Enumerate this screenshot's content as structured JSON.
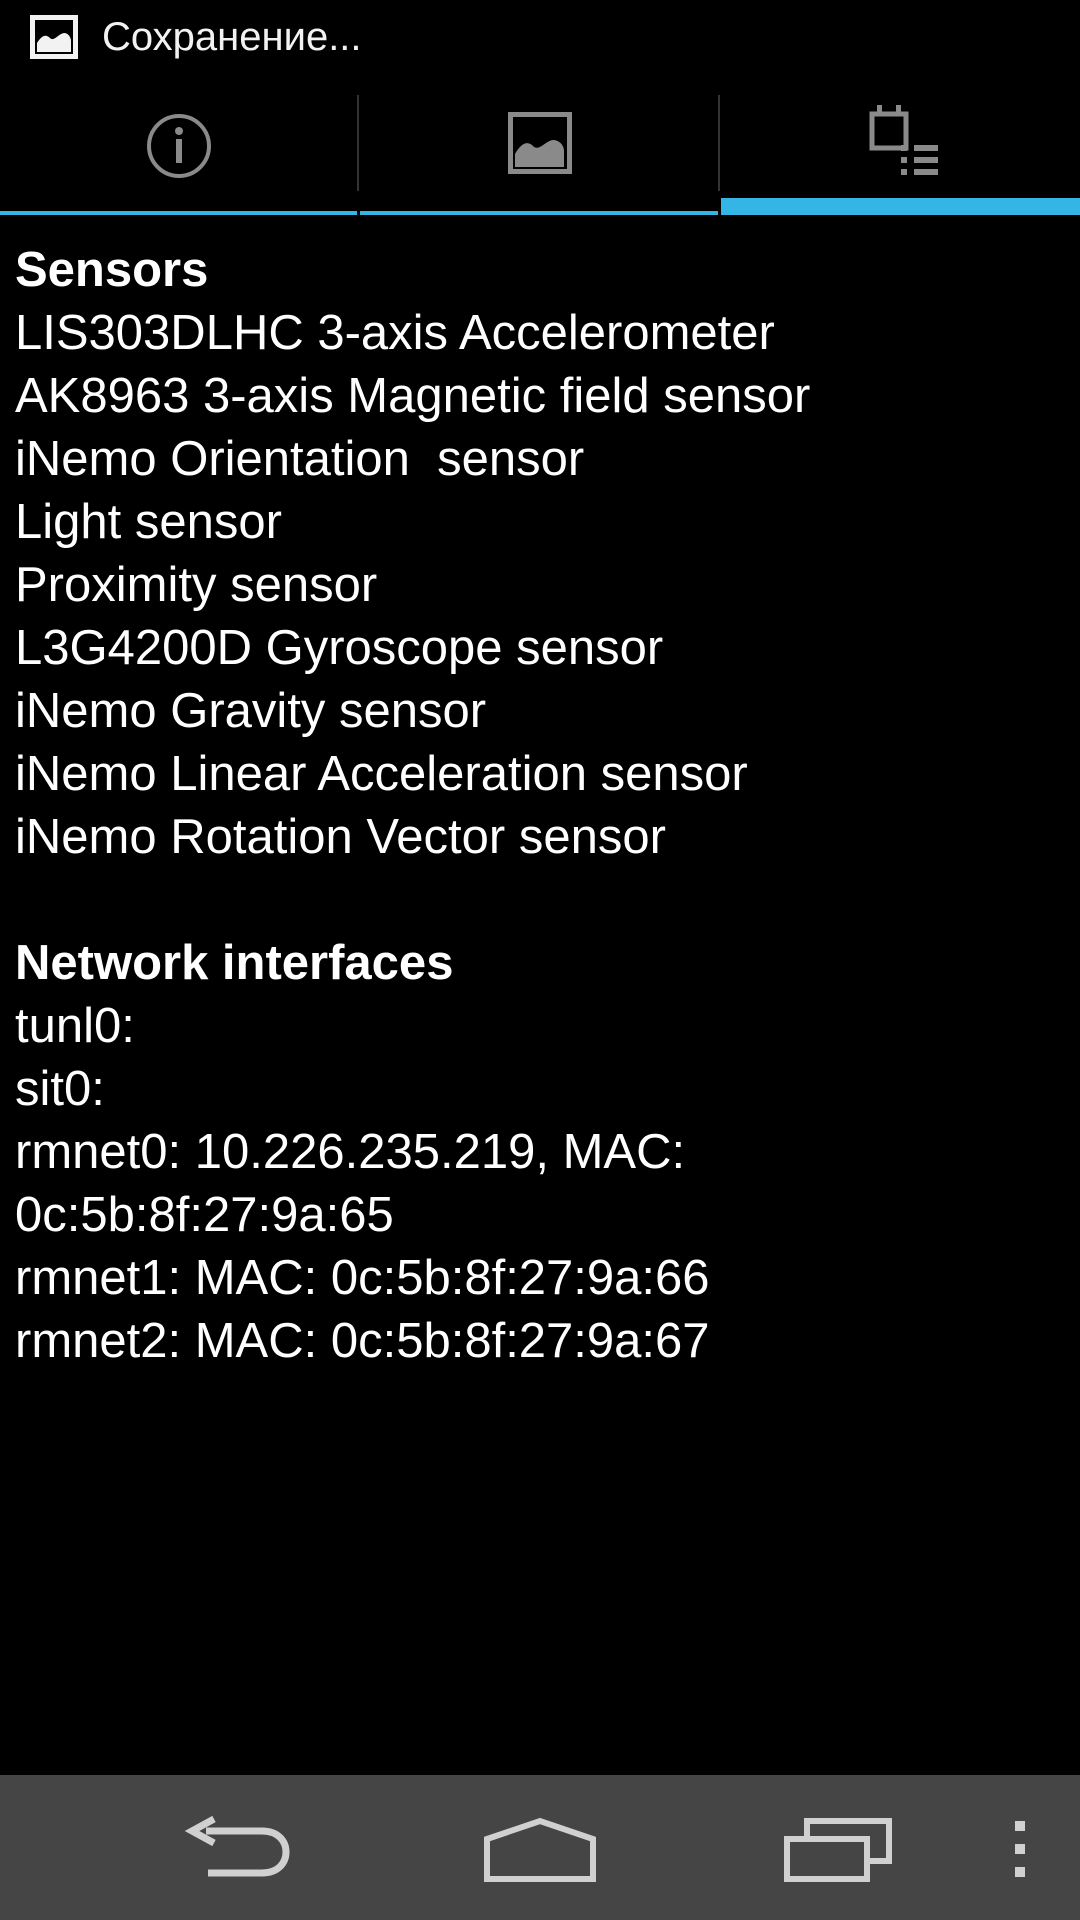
{
  "status_bar": {
    "notification_icon": "image-icon",
    "text": "Сохранение..."
  },
  "tabs": [
    {
      "name": "info",
      "icon": "info-icon",
      "selected": false
    },
    {
      "name": "image",
      "icon": "image-icon",
      "selected": false
    },
    {
      "name": "device",
      "icon": "device-list-icon",
      "selected": true
    }
  ],
  "accent_color": "#33b5e5",
  "content": {
    "sensors": {
      "title": "Sensors",
      "items": [
        "LIS303DLHC 3-axis Accelerometer",
        "AK8963 3-axis Magnetic field sensor",
        "iNemo Orientation  sensor",
        "Light sensor",
        "Proximity sensor",
        "L3G4200D Gyroscope sensor",
        "iNemo Gravity sensor",
        "iNemo Linear Acceleration sensor",
        "iNemo Rotation Vector sensor"
      ]
    },
    "network": {
      "title": "Network interfaces",
      "items": [
        "tunl0:",
        "sit0:",
        "rmnet0: 10.226.235.219, MAC:",
        "0c:5b:8f:27:9a:65",
        "rmnet1: MAC: 0c:5b:8f:27:9a:66",
        "rmnet2: MAC: 0c:5b:8f:27:9a:67"
      ]
    }
  },
  "nav_bar": {
    "buttons": [
      "back-icon",
      "home-icon",
      "recent-apps-icon",
      "overflow-menu-icon"
    ]
  }
}
